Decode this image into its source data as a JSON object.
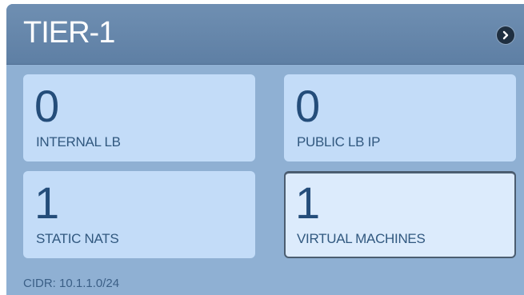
{
  "panel": {
    "title": "TIER-1",
    "nav_icon": "chevron-right-icon"
  },
  "tiles": [
    {
      "value": "0",
      "label": "INTERNAL LB"
    },
    {
      "value": "0",
      "label": "PUBLIC LB IP"
    },
    {
      "value": "1",
      "label": "STATIC NATS"
    },
    {
      "value": "1",
      "label": "VIRTUAL MACHINES"
    }
  ],
  "footer": {
    "cidr": "CIDR: 10.1.1.0/24"
  },
  "colors": {
    "header": "#6f8fb2",
    "panel_bg": "#8fb0d3",
    "tile_bg": "#c3dcf8",
    "tile_selected_bg": "#dcebfc",
    "text_blue": "#244d7a"
  }
}
